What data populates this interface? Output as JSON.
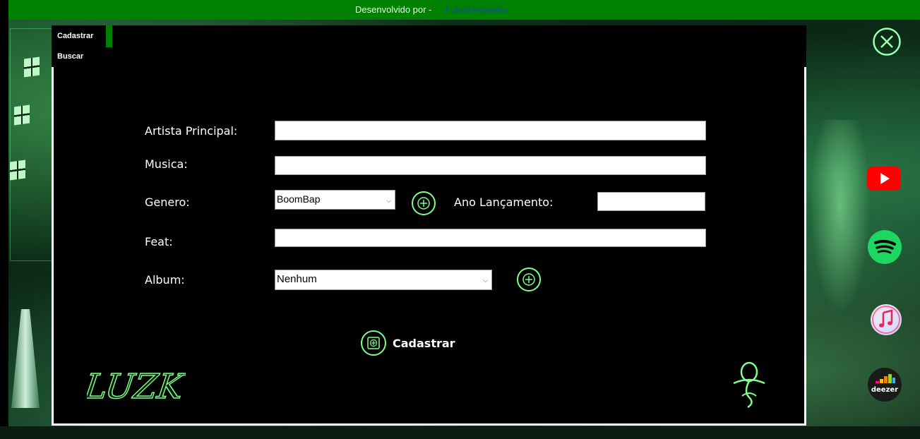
{
  "topbar": {
    "credit_text": "Desenvolvido por -",
    "credit_link": "Lucas Fonseca"
  },
  "tabs": [
    {
      "label": "Cadastrar",
      "active": true
    },
    {
      "label": "Buscar",
      "active": false
    }
  ],
  "form": {
    "artista_label": "Artista Principal:",
    "artista_value": "",
    "musica_label": "Musica:",
    "musica_value": "",
    "genero_label": "Genero:",
    "genero_selected": "BoomBap",
    "ano_label": "Ano Lançamento:",
    "ano_value": "",
    "feat_label": "Feat:",
    "feat_value": "",
    "album_label": "Album:",
    "album_selected": "Nenhum",
    "submit_label": "Cadastrar"
  },
  "branding": {
    "logo_text": "LUZK"
  },
  "side_apps": {
    "deezer_label": "deezer"
  },
  "colors": {
    "accent_green": "#008000",
    "icon_green": "#7dff8a",
    "window_bg": "#000000",
    "youtube_red": "#ff0000",
    "spotify_green": "#1ed760"
  }
}
